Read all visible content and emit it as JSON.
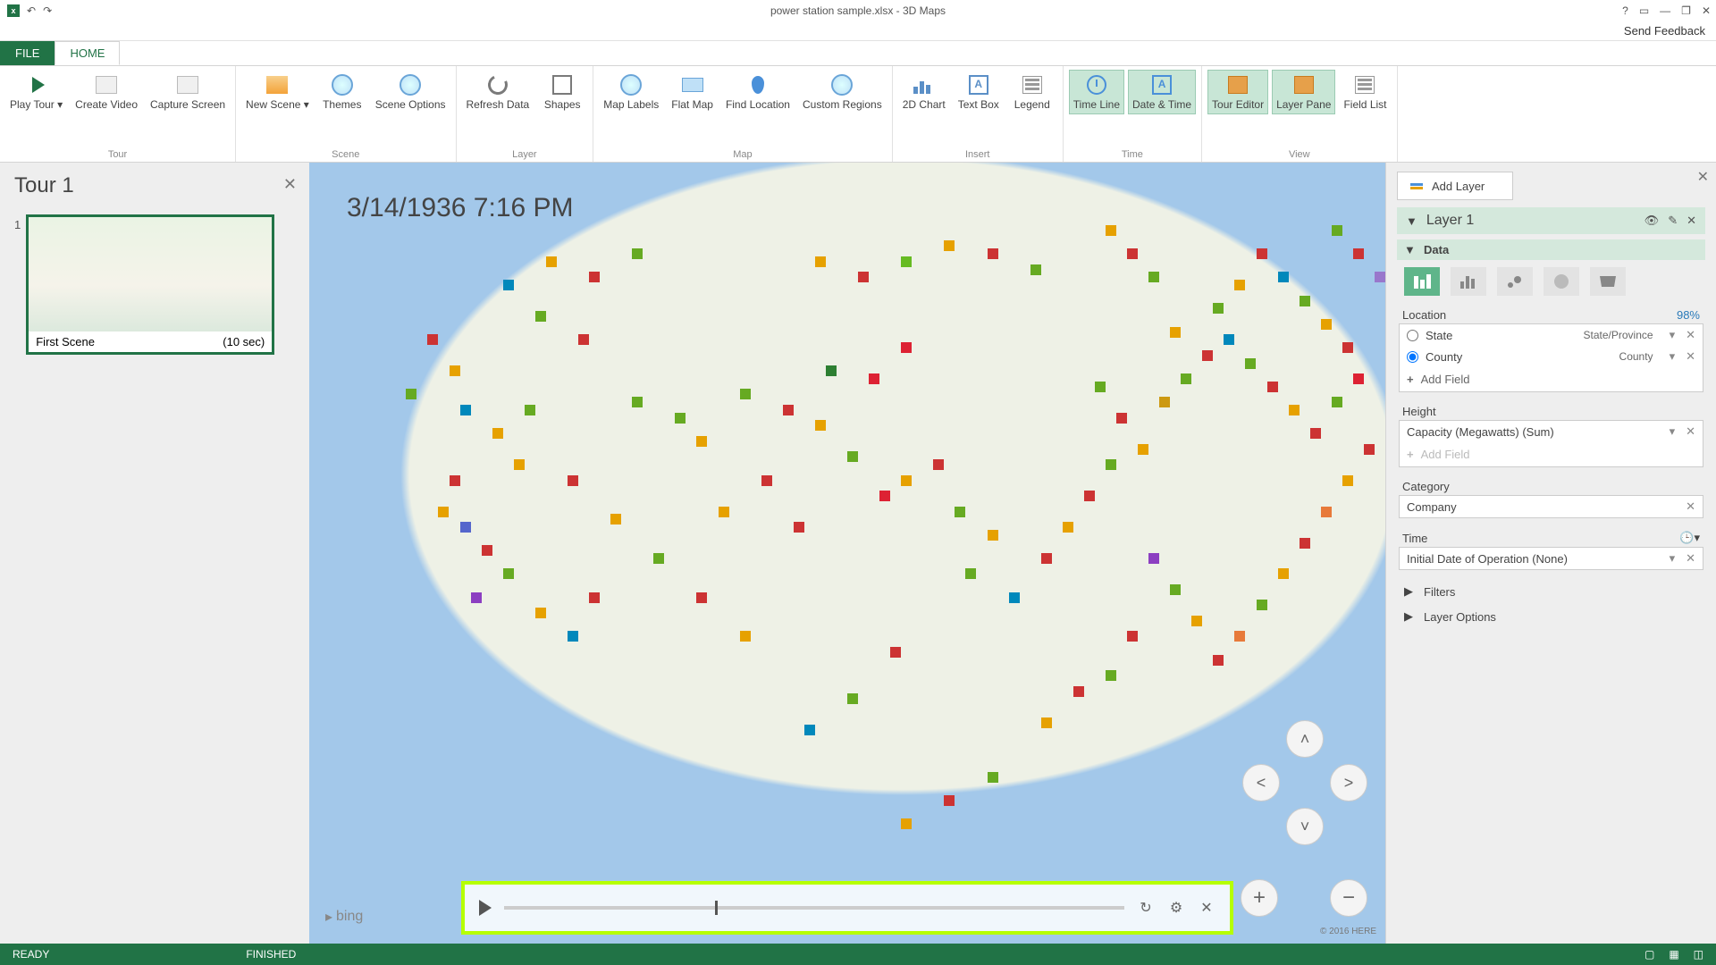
{
  "window": {
    "title": "power station sample.xlsx - 3D Maps",
    "feedback": "Send Feedback"
  },
  "tabs": {
    "file": "FILE",
    "home": "HOME"
  },
  "ribbon": {
    "tour": {
      "label": "Tour",
      "play": "Play Tour ▾",
      "create": "Create Video",
      "capture": "Capture Screen"
    },
    "scene": {
      "label": "Scene",
      "newscene": "New Scene ▾",
      "themes": "Themes",
      "options": "Scene Options"
    },
    "layer": {
      "label": "Layer",
      "refresh": "Refresh Data",
      "shapes": "Shapes"
    },
    "map": {
      "label": "Map",
      "labels": "Map Labels",
      "flat": "Flat Map",
      "find": "Find Location",
      "custom": "Custom Regions"
    },
    "insert": {
      "label": "Insert",
      "chart": "2D Chart",
      "text": "Text Box",
      "legend": "Legend"
    },
    "time": {
      "label": "Time",
      "timeline": "Time Line",
      "datetime": "Date & Time"
    },
    "view": {
      "label": "View",
      "editor": "Tour Editor",
      "pane": "Layer Pane",
      "fieldlist": "Field List"
    }
  },
  "tour": {
    "title": "Tour 1",
    "scenes": [
      {
        "num": "1",
        "name": "First Scene",
        "duration": "(10 sec)"
      }
    ]
  },
  "map": {
    "timestamp": "3/14/1936 7:16 PM",
    "bing": "bing",
    "copyright": "© 2016 HERE",
    "timeline_pos_pct": 34
  },
  "layerpane": {
    "addlayer": "Add Layer",
    "layer": "Layer 1",
    "data": "Data",
    "location": {
      "label": "Location",
      "pct": "98%",
      "rows": [
        {
          "field": "State",
          "type": "State/Province",
          "selected": false
        },
        {
          "field": "County",
          "type": "County",
          "selected": true
        }
      ],
      "add": "Add Field"
    },
    "height": {
      "label": "Height",
      "rows": [
        {
          "field": "Capacity (Megawatts) (Sum)"
        }
      ],
      "add": "Add Field"
    },
    "category": {
      "label": "Category",
      "rows": [
        {
          "field": "Company"
        }
      ]
    },
    "time": {
      "label": "Time",
      "rows": [
        {
          "field": "Initial Date of Operation (None)"
        }
      ]
    },
    "filters": "Filters",
    "options": "Layer Options"
  },
  "status": {
    "ready": "READY",
    "finished": "FINISHED"
  },
  "points": [
    {
      "x": 48,
      "y": 26,
      "c": "#2d7f32"
    },
    {
      "x": 52,
      "y": 27,
      "c": "#d23"
    },
    {
      "x": 55,
      "y": 23,
      "c": "#d23"
    },
    {
      "x": 14,
      "y": 31,
      "c": "#08b"
    },
    {
      "x": 17,
      "y": 34,
      "c": "#e6a100"
    },
    {
      "x": 19,
      "y": 38,
      "c": "#e6a100"
    },
    {
      "x": 13,
      "y": 40,
      "c": "#c33"
    },
    {
      "x": 12,
      "y": 44,
      "c": "#e6a100"
    },
    {
      "x": 14,
      "y": 46,
      "c": "#56c"
    },
    {
      "x": 16,
      "y": 49,
      "c": "#c33"
    },
    {
      "x": 18,
      "y": 52,
      "c": "#6a2"
    },
    {
      "x": 15,
      "y": 55,
      "c": "#8c3fc1"
    },
    {
      "x": 21,
      "y": 57,
      "c": "#e6a100"
    },
    {
      "x": 24,
      "y": 60,
      "c": "#08b"
    },
    {
      "x": 26,
      "y": 55,
      "c": "#c33"
    },
    {
      "x": 30,
      "y": 30,
      "c": "#6a2"
    },
    {
      "x": 34,
      "y": 32,
      "c": "#6a2"
    },
    {
      "x": 36,
      "y": 35,
      "c": "#e6a100"
    },
    {
      "x": 40,
      "y": 29,
      "c": "#6a2"
    },
    {
      "x": 44,
      "y": 31,
      "c": "#c33"
    },
    {
      "x": 47,
      "y": 33,
      "c": "#e6a100"
    },
    {
      "x": 50,
      "y": 37,
      "c": "#6a2"
    },
    {
      "x": 42,
      "y": 40,
      "c": "#c33"
    },
    {
      "x": 38,
      "y": 44,
      "c": "#e6a100"
    },
    {
      "x": 45,
      "y": 46,
      "c": "#c33"
    },
    {
      "x": 53,
      "y": 42,
      "c": "#d23"
    },
    {
      "x": 55,
      "y": 40,
      "c": "#e6a100"
    },
    {
      "x": 58,
      "y": 38,
      "c": "#c33"
    },
    {
      "x": 60,
      "y": 44,
      "c": "#6a2"
    },
    {
      "x": 63,
      "y": 47,
      "c": "#e6a100"
    },
    {
      "x": 61,
      "y": 52,
      "c": "#6a2"
    },
    {
      "x": 65,
      "y": 55,
      "c": "#08b"
    },
    {
      "x": 68,
      "y": 50,
      "c": "#c33"
    },
    {
      "x": 70,
      "y": 46,
      "c": "#e6a100"
    },
    {
      "x": 72,
      "y": 42,
      "c": "#c33"
    },
    {
      "x": 74,
      "y": 38,
      "c": "#6a2"
    },
    {
      "x": 77,
      "y": 36,
      "c": "#e6a100"
    },
    {
      "x": 75,
      "y": 32,
      "c": "#c33"
    },
    {
      "x": 73,
      "y": 28,
      "c": "#6a2"
    },
    {
      "x": 79,
      "y": 30,
      "c": "#c91"
    },
    {
      "x": 81,
      "y": 27,
      "c": "#6a2"
    },
    {
      "x": 83,
      "y": 24,
      "c": "#c33"
    },
    {
      "x": 80,
      "y": 21,
      "c": "#e6a100"
    },
    {
      "x": 85,
      "y": 22,
      "c": "#08b"
    },
    {
      "x": 87,
      "y": 25,
      "c": "#6a2"
    },
    {
      "x": 89,
      "y": 28,
      "c": "#c33"
    },
    {
      "x": 91,
      "y": 31,
      "c": "#e6a100"
    },
    {
      "x": 93,
      "y": 34,
      "c": "#c33"
    },
    {
      "x": 95,
      "y": 30,
      "c": "#6a2"
    },
    {
      "x": 97,
      "y": 27,
      "c": "#d23"
    },
    {
      "x": 96,
      "y": 23,
      "c": "#c33"
    },
    {
      "x": 94,
      "y": 20,
      "c": "#e6a100"
    },
    {
      "x": 92,
      "y": 17,
      "c": "#6a2"
    },
    {
      "x": 90,
      "y": 14,
      "c": "#08b"
    },
    {
      "x": 88,
      "y": 11,
      "c": "#c33"
    },
    {
      "x": 86,
      "y": 15,
      "c": "#e6a100"
    },
    {
      "x": 84,
      "y": 18,
      "c": "#6a2"
    },
    {
      "x": 98,
      "y": 36,
      "c": "#c33"
    },
    {
      "x": 96,
      "y": 40,
      "c": "#e6a100"
    },
    {
      "x": 94,
      "y": 44,
      "c": "#e77a3a"
    },
    {
      "x": 92,
      "y": 48,
      "c": "#c33"
    },
    {
      "x": 90,
      "y": 52,
      "c": "#e6a100"
    },
    {
      "x": 88,
      "y": 56,
      "c": "#6a2"
    },
    {
      "x": 86,
      "y": 60,
      "c": "#e77a3a"
    },
    {
      "x": 84,
      "y": 63,
      "c": "#c33"
    },
    {
      "x": 82,
      "y": 58,
      "c": "#e6a100"
    },
    {
      "x": 80,
      "y": 54,
      "c": "#6a2"
    },
    {
      "x": 78,
      "y": 50,
      "c": "#8c3fc1"
    },
    {
      "x": 76,
      "y": 60,
      "c": "#c33"
    },
    {
      "x": 74,
      "y": 65,
      "c": "#6a2"
    },
    {
      "x": 71,
      "y": 67,
      "c": "#c33"
    },
    {
      "x": 68,
      "y": 71,
      "c": "#e6a100"
    },
    {
      "x": 54,
      "y": 62,
      "c": "#c33"
    },
    {
      "x": 50,
      "y": 68,
      "c": "#6a2"
    },
    {
      "x": 46,
      "y": 72,
      "c": "#08b"
    },
    {
      "x": 40,
      "y": 60,
      "c": "#e6a100"
    },
    {
      "x": 36,
      "y": 55,
      "c": "#c33"
    },
    {
      "x": 32,
      "y": 50,
      "c": "#6a2"
    },
    {
      "x": 28,
      "y": 45,
      "c": "#e6a100"
    },
    {
      "x": 24,
      "y": 40,
      "c": "#c33"
    },
    {
      "x": 20,
      "y": 31,
      "c": "#6a2"
    },
    {
      "x": 99,
      "y": 14,
      "c": "#97c"
    },
    {
      "x": 97,
      "y": 11,
      "c": "#c33"
    },
    {
      "x": 95,
      "y": 8,
      "c": "#6a2"
    },
    {
      "x": 78,
      "y": 14,
      "c": "#6a2"
    },
    {
      "x": 76,
      "y": 11,
      "c": "#c33"
    },
    {
      "x": 74,
      "y": 8,
      "c": "#e6a100"
    },
    {
      "x": 67,
      "y": 13,
      "c": "#6a2"
    },
    {
      "x": 63,
      "y": 11,
      "c": "#c33"
    },
    {
      "x": 59,
      "y": 10,
      "c": "#e6a100"
    },
    {
      "x": 55,
      "y": 12,
      "c": "#6b2"
    },
    {
      "x": 51,
      "y": 14,
      "c": "#c33"
    },
    {
      "x": 47,
      "y": 12,
      "c": "#e6a100"
    },
    {
      "x": 30,
      "y": 11,
      "c": "#6a2"
    },
    {
      "x": 26,
      "y": 14,
      "c": "#c33"
    },
    {
      "x": 22,
      "y": 12,
      "c": "#e6a100"
    },
    {
      "x": 18,
      "y": 15,
      "c": "#08b"
    },
    {
      "x": 21,
      "y": 19,
      "c": "#6a2"
    },
    {
      "x": 25,
      "y": 22,
      "c": "#c33"
    },
    {
      "x": 11,
      "y": 22,
      "c": "#c33"
    },
    {
      "x": 13,
      "y": 26,
      "c": "#e6a100"
    },
    {
      "x": 9,
      "y": 29,
      "c": "#6a2"
    },
    {
      "x": 63,
      "y": 78,
      "c": "#6a2"
    },
    {
      "x": 59,
      "y": 81,
      "c": "#c33"
    },
    {
      "x": 55,
      "y": 84,
      "c": "#e6a100"
    }
  ]
}
